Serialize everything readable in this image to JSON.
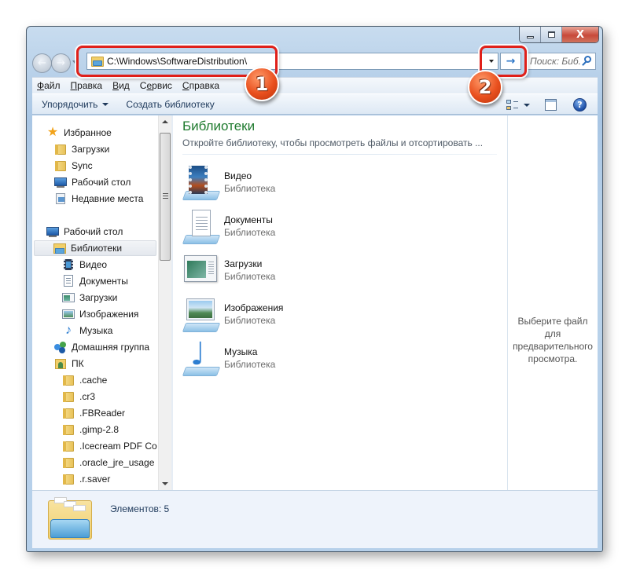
{
  "window": {
    "caption_buttons": {
      "minimize": "minimize-icon",
      "maximize": "maximize-icon",
      "close_label": "X"
    }
  },
  "navigation": {
    "back_icon": "back-arrow-icon",
    "forward_icon": "forward-arrow-icon",
    "address_value": "C:\\Windows\\SoftwareDistribution\\",
    "go_icon": "→",
    "search_placeholder": "Поиск: Биб..."
  },
  "callouts": [
    {
      "number": "1",
      "target": "address-bar"
    },
    {
      "number": "2",
      "target": "go-button"
    }
  ],
  "menu": {
    "items": [
      {
        "accel": "Ф",
        "rest": "айл"
      },
      {
        "accel": "П",
        "rest": "равка"
      },
      {
        "accel": "В",
        "rest": "ид"
      },
      {
        "pre": "С",
        "accel": "е",
        "rest": "рвис"
      },
      {
        "accel": "С",
        "rest": "правка"
      }
    ]
  },
  "toolbar": {
    "organize_label": "Упорядочить",
    "create_library_label": "Создать библиотеку",
    "help_label": "?"
  },
  "nav_pane": {
    "items": [
      {
        "label": "Избранное",
        "icon": "star-icon"
      },
      {
        "label": "Загрузки",
        "icon": "downloads-folder-icon"
      },
      {
        "label": "Sync",
        "icon": "folder-icon"
      },
      {
        "label": "Рабочий стол",
        "icon": "desktop-icon"
      },
      {
        "label": "Недавние места",
        "icon": "recent-places-icon"
      },
      {
        "label": "Рабочий стол",
        "icon": "desktop-icon"
      },
      {
        "label": "Библиотеки",
        "icon": "libraries-icon",
        "selected": true
      },
      {
        "label": "Видео",
        "icon": "video-library-icon"
      },
      {
        "label": "Документы",
        "icon": "documents-library-icon"
      },
      {
        "label": "Загрузки",
        "icon": "downloads-library-icon"
      },
      {
        "label": "Изображения",
        "icon": "pictures-library-icon"
      },
      {
        "label": "Музыка",
        "icon": "music-library-icon"
      },
      {
        "label": "Домашняя группа",
        "icon": "homegroup-icon"
      },
      {
        "label": "ПК",
        "icon": "computer-icon"
      },
      {
        "label": ".cache",
        "icon": "folder-icon"
      },
      {
        "label": ".cr3",
        "icon": "folder-icon"
      },
      {
        "label": ".FBReader",
        "icon": "folder-icon"
      },
      {
        "label": ".gimp-2.8",
        "icon": "folder-icon"
      },
      {
        "label": ".Icecream PDF Co",
        "icon": "folder-icon"
      },
      {
        "label": ".oracle_jre_usage",
        "icon": "folder-icon"
      },
      {
        "label": ".r.saver",
        "icon": "folder-icon"
      }
    ]
  },
  "main": {
    "title": "Библиотеки",
    "subtitle": "Откройте библиотеку, чтобы просмотреть файлы и отсортировать ...",
    "libraries": [
      {
        "name": "Видео",
        "type": "Библиотека"
      },
      {
        "name": "Документы",
        "type": "Библиотека"
      },
      {
        "name": "Загрузки",
        "type": "Библиотека"
      },
      {
        "name": "Изображения",
        "type": "Библиотека"
      },
      {
        "name": "Музыка",
        "type": "Библиотека"
      }
    ]
  },
  "preview": {
    "message": "Выберите файл для предварительного просмотра."
  },
  "details": {
    "count_text": "Элементов: 5"
  }
}
